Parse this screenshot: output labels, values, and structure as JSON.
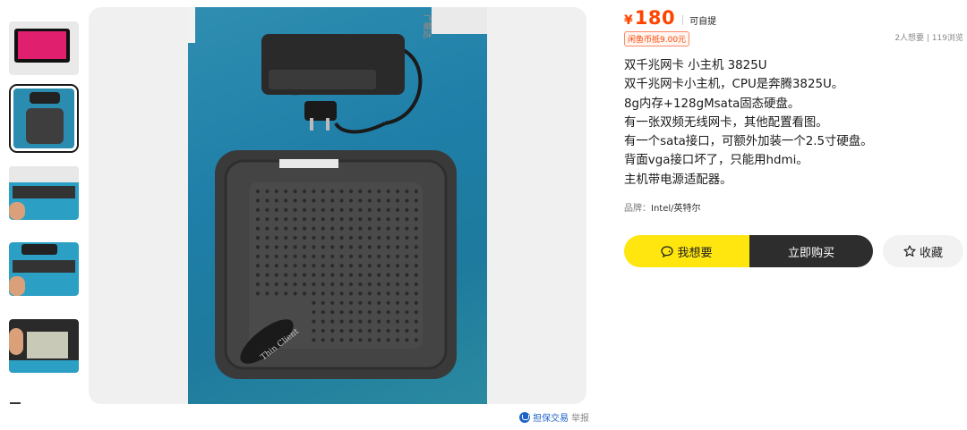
{
  "price": {
    "symbol": "¥",
    "amount": "180",
    "pickup": "可自提"
  },
  "coupon": "闲鱼币抵9.00元",
  "stats": "2人想要 | 119浏览",
  "description": {
    "lines": [
      "双千兆网卡 小主机 3825U",
      "双千兆网卡小主机，CPU是奔腾3825U。",
      "8g内存+128gMsata固态硬盘。",
      "有一张双频无线网卡，其他配置看图。",
      "有一个sata接口，可额外加装一个2.5寸硬盘。",
      "背面vga接口坏了，只能用hdmi。",
      "主机带电源适配器。"
    ]
  },
  "brand": {
    "label": "品牌：",
    "value": "Intel/英特尔"
  },
  "buttons": {
    "want": "我想要",
    "buy": "立即购买",
    "favorite": "收藏"
  },
  "footer": {
    "guarantee": "担保交易",
    "report": "举报"
  },
  "photo": {
    "box_text_top": "广联达",
    "device_label": "Thin Client"
  },
  "colors": {
    "accent": "#ff4400",
    "want": "#ffe60f",
    "buy": "#2d2d2d"
  }
}
